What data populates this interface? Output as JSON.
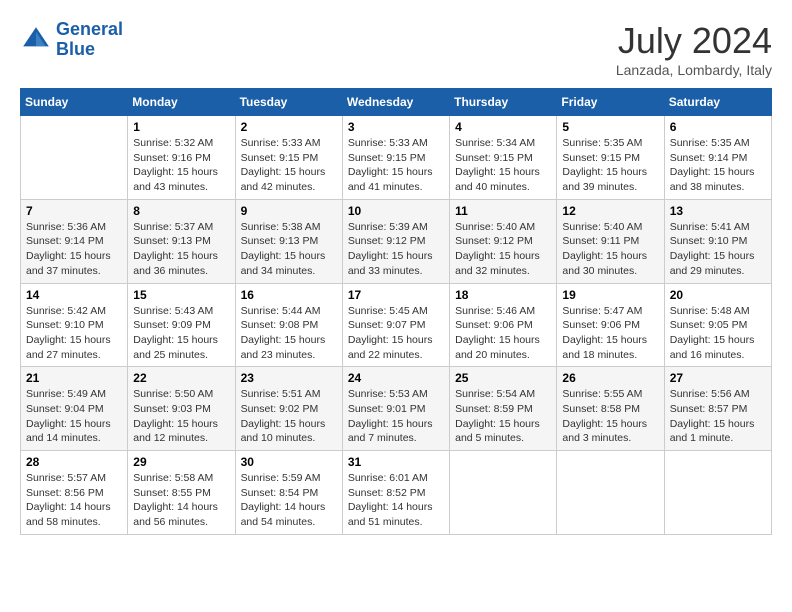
{
  "header": {
    "logo_line1": "General",
    "logo_line2": "Blue",
    "month_year": "July 2024",
    "location": "Lanzada, Lombardy, Italy"
  },
  "weekdays": [
    "Sunday",
    "Monday",
    "Tuesday",
    "Wednesday",
    "Thursday",
    "Friday",
    "Saturday"
  ],
  "weeks": [
    [
      {
        "day": "",
        "info": ""
      },
      {
        "day": "1",
        "info": "Sunrise: 5:32 AM\nSunset: 9:16 PM\nDaylight: 15 hours\nand 43 minutes."
      },
      {
        "day": "2",
        "info": "Sunrise: 5:33 AM\nSunset: 9:15 PM\nDaylight: 15 hours\nand 42 minutes."
      },
      {
        "day": "3",
        "info": "Sunrise: 5:33 AM\nSunset: 9:15 PM\nDaylight: 15 hours\nand 41 minutes."
      },
      {
        "day": "4",
        "info": "Sunrise: 5:34 AM\nSunset: 9:15 PM\nDaylight: 15 hours\nand 40 minutes."
      },
      {
        "day": "5",
        "info": "Sunrise: 5:35 AM\nSunset: 9:15 PM\nDaylight: 15 hours\nand 39 minutes."
      },
      {
        "day": "6",
        "info": "Sunrise: 5:35 AM\nSunset: 9:14 PM\nDaylight: 15 hours\nand 38 minutes."
      }
    ],
    [
      {
        "day": "7",
        "info": "Sunrise: 5:36 AM\nSunset: 9:14 PM\nDaylight: 15 hours\nand 37 minutes."
      },
      {
        "day": "8",
        "info": "Sunrise: 5:37 AM\nSunset: 9:13 PM\nDaylight: 15 hours\nand 36 minutes."
      },
      {
        "day": "9",
        "info": "Sunrise: 5:38 AM\nSunset: 9:13 PM\nDaylight: 15 hours\nand 34 minutes."
      },
      {
        "day": "10",
        "info": "Sunrise: 5:39 AM\nSunset: 9:12 PM\nDaylight: 15 hours\nand 33 minutes."
      },
      {
        "day": "11",
        "info": "Sunrise: 5:40 AM\nSunset: 9:12 PM\nDaylight: 15 hours\nand 32 minutes."
      },
      {
        "day": "12",
        "info": "Sunrise: 5:40 AM\nSunset: 9:11 PM\nDaylight: 15 hours\nand 30 minutes."
      },
      {
        "day": "13",
        "info": "Sunrise: 5:41 AM\nSunset: 9:10 PM\nDaylight: 15 hours\nand 29 minutes."
      }
    ],
    [
      {
        "day": "14",
        "info": "Sunrise: 5:42 AM\nSunset: 9:10 PM\nDaylight: 15 hours\nand 27 minutes."
      },
      {
        "day": "15",
        "info": "Sunrise: 5:43 AM\nSunset: 9:09 PM\nDaylight: 15 hours\nand 25 minutes."
      },
      {
        "day": "16",
        "info": "Sunrise: 5:44 AM\nSunset: 9:08 PM\nDaylight: 15 hours\nand 23 minutes."
      },
      {
        "day": "17",
        "info": "Sunrise: 5:45 AM\nSunset: 9:07 PM\nDaylight: 15 hours\nand 22 minutes."
      },
      {
        "day": "18",
        "info": "Sunrise: 5:46 AM\nSunset: 9:06 PM\nDaylight: 15 hours\nand 20 minutes."
      },
      {
        "day": "19",
        "info": "Sunrise: 5:47 AM\nSunset: 9:06 PM\nDaylight: 15 hours\nand 18 minutes."
      },
      {
        "day": "20",
        "info": "Sunrise: 5:48 AM\nSunset: 9:05 PM\nDaylight: 15 hours\nand 16 minutes."
      }
    ],
    [
      {
        "day": "21",
        "info": "Sunrise: 5:49 AM\nSunset: 9:04 PM\nDaylight: 15 hours\nand 14 minutes."
      },
      {
        "day": "22",
        "info": "Sunrise: 5:50 AM\nSunset: 9:03 PM\nDaylight: 15 hours\nand 12 minutes."
      },
      {
        "day": "23",
        "info": "Sunrise: 5:51 AM\nSunset: 9:02 PM\nDaylight: 15 hours\nand 10 minutes."
      },
      {
        "day": "24",
        "info": "Sunrise: 5:53 AM\nSunset: 9:01 PM\nDaylight: 15 hours\nand 7 minutes."
      },
      {
        "day": "25",
        "info": "Sunrise: 5:54 AM\nSunset: 8:59 PM\nDaylight: 15 hours\nand 5 minutes."
      },
      {
        "day": "26",
        "info": "Sunrise: 5:55 AM\nSunset: 8:58 PM\nDaylight: 15 hours\nand 3 minutes."
      },
      {
        "day": "27",
        "info": "Sunrise: 5:56 AM\nSunset: 8:57 PM\nDaylight: 15 hours\nand 1 minute."
      }
    ],
    [
      {
        "day": "28",
        "info": "Sunrise: 5:57 AM\nSunset: 8:56 PM\nDaylight: 14 hours\nand 58 minutes."
      },
      {
        "day": "29",
        "info": "Sunrise: 5:58 AM\nSunset: 8:55 PM\nDaylight: 14 hours\nand 56 minutes."
      },
      {
        "day": "30",
        "info": "Sunrise: 5:59 AM\nSunset: 8:54 PM\nDaylight: 14 hours\nand 54 minutes."
      },
      {
        "day": "31",
        "info": "Sunrise: 6:01 AM\nSunset: 8:52 PM\nDaylight: 14 hours\nand 51 minutes."
      },
      {
        "day": "",
        "info": ""
      },
      {
        "day": "",
        "info": ""
      },
      {
        "day": "",
        "info": ""
      }
    ]
  ]
}
